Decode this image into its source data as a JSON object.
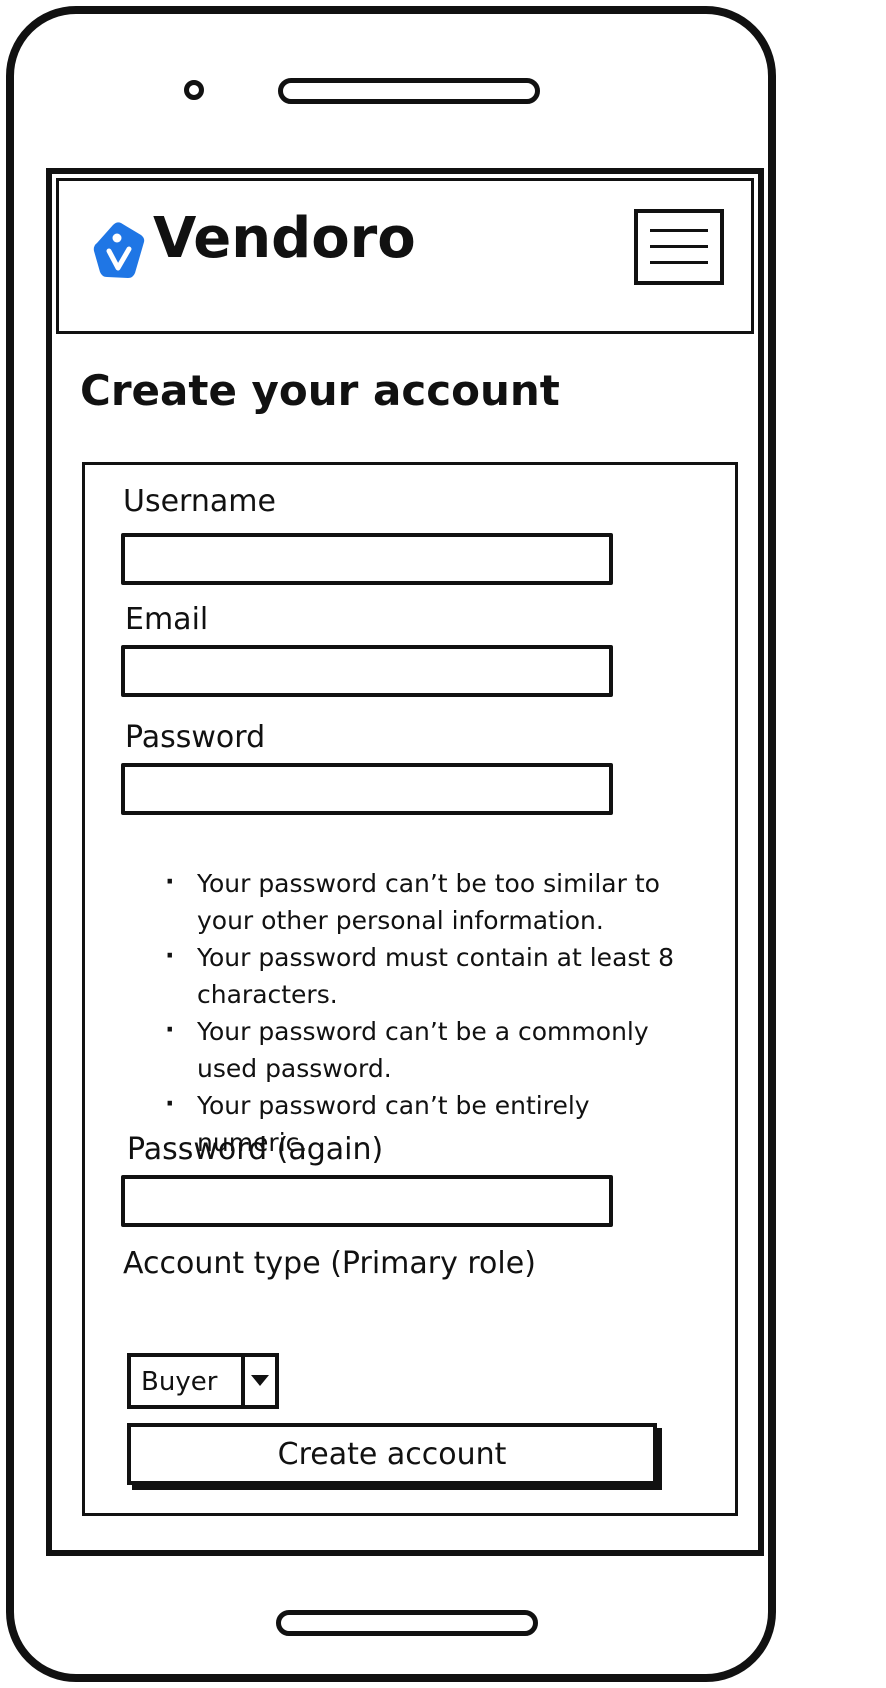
{
  "header": {
    "brand": "Vendoro",
    "logo_icon": "tag-icon",
    "menu_icon": "hamburger-icon"
  },
  "colors": {
    "accent": "#1f76e5",
    "ink": "#111111",
    "background": "#ffffff"
  },
  "page": {
    "title": "Create your account"
  },
  "form": {
    "username": {
      "label": "Username",
      "value": "",
      "placeholder": ""
    },
    "email": {
      "label": "Email",
      "value": "",
      "placeholder": ""
    },
    "password": {
      "label": "Password",
      "value": "",
      "placeholder": ""
    },
    "password_help": [
      "Your password can’t be too similar to your other personal information.",
      "Your password must contain at least 8 characters.",
      "Your password can’t be a commonly used password.",
      "Your password can’t be entirely numeric."
    ],
    "password_again": {
      "label": "Password (again)",
      "value": "",
      "placeholder": ""
    },
    "account_type": {
      "label": "Account type (Primary role)",
      "selected": "Buyer"
    },
    "submit_label": "Create account"
  }
}
